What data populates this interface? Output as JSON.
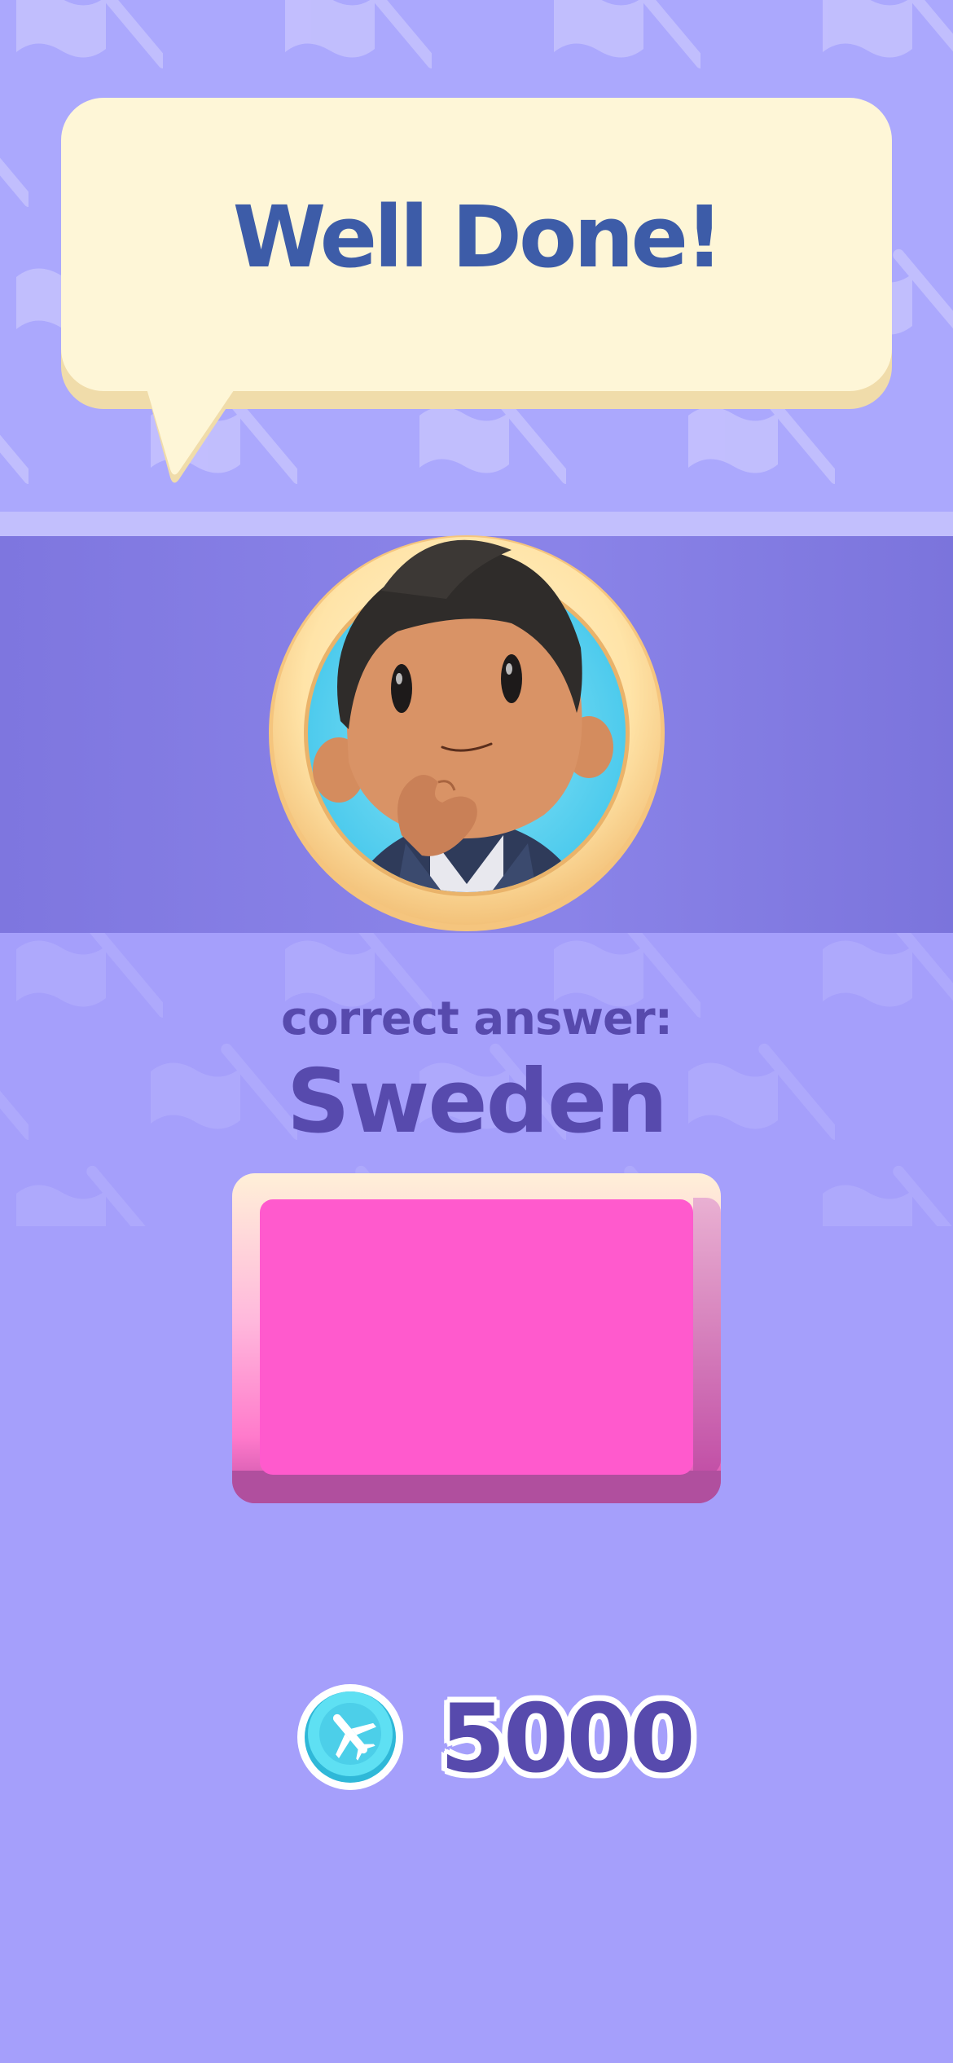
{
  "header": {
    "title": "Well Done!"
  },
  "avatar": {
    "description": "player-avatar"
  },
  "result": {
    "label": "correct answer:",
    "answer": "Sweden"
  },
  "flag_card": {
    "color": "#ff5acd"
  },
  "reward": {
    "icon": "plane-coin-icon",
    "amount": "5000"
  },
  "colors": {
    "background": "#a59ffb",
    "band": "#8a83e8",
    "bubble": "#fef6d7",
    "title": "#3d5ca8",
    "text": "#574aad",
    "coin": "#4fd6f0"
  }
}
